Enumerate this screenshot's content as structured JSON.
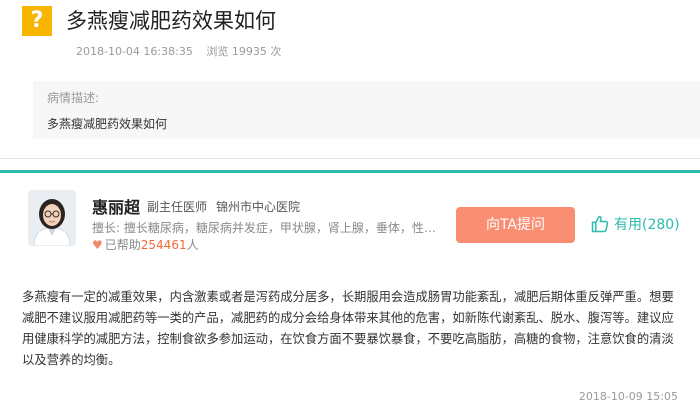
{
  "question": {
    "badge": "?",
    "title": "多燕瘦减肥药效果如何",
    "datetime": "2018-10-04 16:38:35",
    "views_label": "浏览 19935 次"
  },
  "description": {
    "label": "病情描述:",
    "text": "多燕瘦减肥药效果如何"
  },
  "doctor": {
    "name": "惠丽超",
    "title": "副主任医师",
    "hospital": "锦州市中心医院",
    "specialty": "擅长: 擅长糖尿病，糖尿病并发症，甲状腺，肾上腺，垂体，性腺...",
    "helped_prefix": "已帮助",
    "helped_count": "254461",
    "helped_suffix": "人"
  },
  "actions": {
    "ask_label": "向TA提问",
    "useful_label": "有用(280)"
  },
  "answer": {
    "text": "多燕瘦有一定的减重效果，内含激素或者是泻药成分居多，长期服用会造成肠胃功能紊乱，减肥后期体重反弹严重。想要减肥不建议服用减肥药等一类的产品，减肥药的成分会给身体带来其他的危害，如新陈代谢紊乱、脱水、腹泻等。建议应用健康科学的减肥方法，控制食欲多参加运动，在饮食方面不要暴饮暴食，不要吃高脂肪，高糖的食物，注意饮食的清淡以及营养的均衡。",
    "datetime": "2018-10-09 15:05"
  },
  "colors": {
    "badge": "#f7b500",
    "accent_teal": "#2bbbad",
    "ask_button": "#fa8e72",
    "helped_count": "#f26b3a"
  },
  "icons": {
    "badge": "question-mark-icon",
    "helped": "heart-icon",
    "useful": "thumbs-up-icon"
  }
}
